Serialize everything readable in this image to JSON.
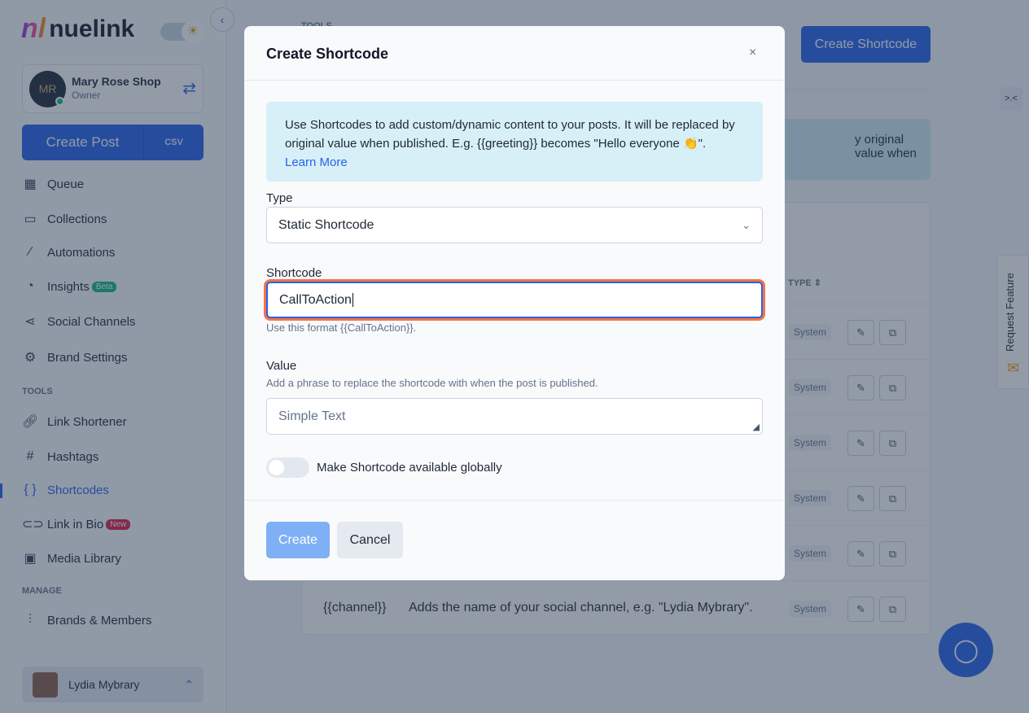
{
  "sidebar": {
    "logo": "nuelink",
    "brand_name": "Mary Rose Shop",
    "brand_role": "Owner",
    "brand_initials": "MR",
    "create_post": "Create Post",
    "csv": "CSV",
    "items": [
      {
        "label": "Queue",
        "icon": "calendar"
      },
      {
        "label": "Collections",
        "icon": "folder"
      },
      {
        "label": "Automations",
        "icon": "magic-wand"
      },
      {
        "label": "Insights",
        "icon": "pie-chart",
        "badge": "Beta"
      },
      {
        "label": "Social Channels",
        "icon": "share"
      },
      {
        "label": "Brand Settings",
        "icon": "gear"
      }
    ],
    "tools_heading": "TOOLS",
    "tools": [
      {
        "label": "Link Shortener",
        "icon": "link"
      },
      {
        "label": "Hashtags",
        "icon": "hash"
      },
      {
        "label": "Shortcodes",
        "icon": "braces",
        "active": true
      },
      {
        "label": "Link in Bio",
        "icon": "link",
        "badge": "New"
      },
      {
        "label": "Media Library",
        "icon": "image"
      }
    ],
    "manage_heading": "MANAGE",
    "manage": [
      {
        "label": "Brands & Members",
        "icon": "sliders"
      }
    ],
    "user": "Lydia Mybrary"
  },
  "background": {
    "tools_label": "TOOLS",
    "create_shortcode": "Create Shortcode",
    "info_fragment": "y original value when",
    "type_header": "TYPE",
    "rows": [
      {
        "type": "System"
      },
      {
        "type": "System"
      },
      {
        "type": "System"
      },
      {
        "type": "System"
      },
      {
        "type": "System"
      },
      {
        "code": "{{channel}}",
        "desc": "Adds the name of your social channel, e.g. \"Lydia Mybrary\".",
        "type": "System"
      }
    ],
    "request_feature": "Request Feature"
  },
  "modal": {
    "title": "Create Shortcode",
    "close": "×",
    "info": "Use Shortcodes to add custom/dynamic content to your posts. It will be replaced by original value when published. E.g. {{greeting}} becomes \"Hello everyone 👏\".",
    "learn_more": "Learn More",
    "type_label": "Type",
    "type_value": "Static Shortcode",
    "shortcode_label": "Shortcode",
    "shortcode_value": "CallToAction",
    "shortcode_hint": "Use this format {{CallToAction}}.",
    "value_label": "Value",
    "value_hint": "Add a phrase to replace the shortcode with when the post is published.",
    "value_placeholder": "Simple Text",
    "global_toggle_label": "Make Shortcode available globally",
    "global_toggle_on": false,
    "create": "Create",
    "cancel": "Cancel"
  },
  "colors": {
    "primary": "#2563eb",
    "focus_ring": "#f97345",
    "beta": "#10b981",
    "new": "#e11d48"
  }
}
